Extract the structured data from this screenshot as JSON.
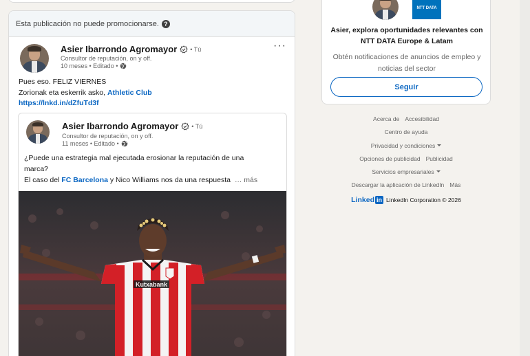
{
  "promo": {
    "notice": "Esta publicación no puede promocionarse."
  },
  "post": {
    "author": "Asier Ibarrondo Agromayor",
    "degree": "• Tú",
    "headline": "Consultor de reputación, on y off.",
    "meta": "10 meses • Editado •",
    "more_label": "···",
    "text_line1": "Pues eso. FELIZ VIERNES",
    "text_line2": "Zorionak eta eskerrik asko, ",
    "mention": "Athletic Club",
    "link": "https://lnkd.in/dZfuTd3f"
  },
  "reshare": {
    "author": "Asier Ibarrondo Agromayor",
    "degree": "• Tú",
    "headline": "Consultor de reputación, on y off.",
    "meta": "11 meses • Editado •",
    "line1": "¿Puede una estrategia mal ejecutada erosionar la reputación de una",
    "line2": "marca?",
    "line3_pre": "El caso del ",
    "mention": "FC Barcelona",
    "line3_post": " y Nico Williams nos da una respuesta",
    "see_more": "… más",
    "sponsor": "Kutxabank"
  },
  "company_card": {
    "logo_text": "NTT DATA",
    "title": "Asier, explora oportunidades relevantes con NTT DATA Europe & Latam",
    "subtitle": "Obtén notificaciones de anuncios de empleo y noticias del sector",
    "follow_label": "Seguir"
  },
  "footer": {
    "about": "Acerca de",
    "accessibility": "Accesibilidad",
    "help": "Centro de ayuda",
    "privacy": "Privacidad y condiciones",
    "ad_options": "Opciones de publicidad",
    "advertising": "Publicidad",
    "business": "Servicios empresariales",
    "app": "Descargar la aplicación de LinkedIn",
    "more": "Más",
    "brand_word": "Linked",
    "brand_box": "in",
    "corp": "LinkedIn Corporation © 2026"
  },
  "colors": {
    "brand_blue": "#0a66c2",
    "ntt_blue": "#0072bc",
    "page_bg": "#f4f2ee"
  }
}
